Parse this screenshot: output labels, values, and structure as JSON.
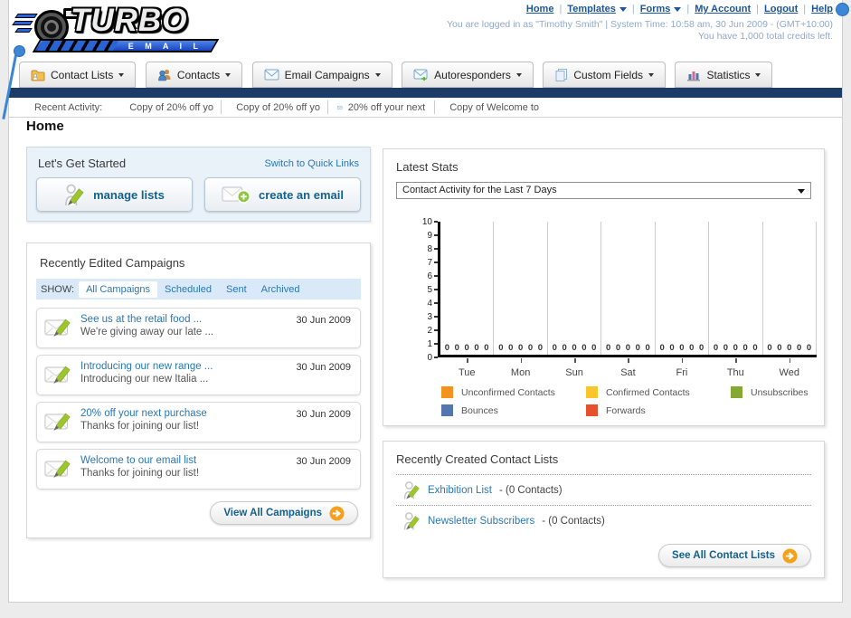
{
  "colors": {
    "navy_bar": "#1B3C66",
    "link_blue": "#2A77B5",
    "header_link_blue": "#1A5699",
    "button_text_blue": "#14618F",
    "accent_orange": "#F5A11C",
    "get_started_bg": "#E9F1F9"
  },
  "header": {
    "logo_title": "TURBO",
    "logo_subtitle": "E M A I L",
    "separator": "|",
    "nav": [
      {
        "label": "Home",
        "dropdown": false
      },
      {
        "label": "Templates",
        "dropdown": true
      },
      {
        "label": "Forms",
        "dropdown": true
      },
      {
        "label": "My Account",
        "dropdown": false
      },
      {
        "label": "Logout",
        "dropdown": false
      },
      {
        "label": "Help",
        "dropdown": false
      }
    ],
    "login_info": "You are logged in as \"Timothy Smith\" | System Time: 10:58 am, 30 Jun 2009 - (GMT+10:00)",
    "credits_info": "You have 1,000 total credits left."
  },
  "nav_tabs": [
    {
      "label": "Contact Lists",
      "icon": "folder-icon"
    },
    {
      "label": "Contacts",
      "icon": "people-icon"
    },
    {
      "label": "Email Campaigns",
      "icon": "envelope-icon"
    },
    {
      "label": "Autoresponders",
      "icon": "envelope-arrow-icon"
    },
    {
      "label": "Custom Fields",
      "icon": "pages-icon"
    },
    {
      "label": "Statistics",
      "icon": "bar-chart-icon"
    }
  ],
  "recent_activity": {
    "label": "Recent Activity:",
    "items": [
      "Copy of 20% off yo",
      "Copy of 20% off yo",
      "20% off your next",
      "Copy of Welcome to"
    ]
  },
  "page_title": "Home",
  "get_started": {
    "title": "Let's Get Started",
    "switch_link": "Switch to Quick Links",
    "manage_lists_label": "manage lists",
    "create_email_label": "create an email"
  },
  "campaigns": {
    "title": "Recently Edited Campaigns",
    "show_label": "SHOW:",
    "filters": [
      "All Campaigns",
      "Scheduled",
      "Sent",
      "Archived"
    ],
    "active_filter": "All Campaigns",
    "items": [
      {
        "title": "See us at the retail food ...",
        "subtitle": "We're giving away our late ...",
        "date": "30 Jun 2009"
      },
      {
        "title": "Introducing our new range ...",
        "subtitle": "Introducing our new Italia ...",
        "date": "30 Jun 2009"
      },
      {
        "title": "20% off your next purchase",
        "subtitle": "Thanks for joining our list!",
        "date": "30 Jun 2009"
      },
      {
        "title": "Welcome to our email list",
        "subtitle": "Thanks for joining our list!",
        "date": "30 Jun 2009"
      }
    ],
    "view_all_label": "View All Campaigns"
  },
  "stats": {
    "title": "Latest Stats",
    "dropdown_value": "Contact Activity for the Last 7 Days",
    "chart_data": {
      "type": "bar",
      "categories": [
        "Tue",
        "Mon",
        "Sun",
        "Sat",
        "Fri",
        "Thu",
        "Wed"
      ],
      "series": [
        {
          "name": "Unconfirmed Contacts",
          "color": "#F5911E",
          "values": [
            0,
            0,
            0,
            0,
            0,
            0,
            0
          ]
        },
        {
          "name": "Confirmed Contacts",
          "color": "#FAC62C",
          "values": [
            0,
            0,
            0,
            0,
            0,
            0,
            0
          ]
        },
        {
          "name": "Unsubscribes",
          "color": "#84A832",
          "values": [
            0,
            0,
            0,
            0,
            0,
            0,
            0
          ]
        },
        {
          "name": "Bounces",
          "color": "#5575AE",
          "values": [
            0,
            0,
            0,
            0,
            0,
            0,
            0
          ]
        },
        {
          "name": "Forwards",
          "color": "#E6502A",
          "values": [
            0,
            0,
            0,
            0,
            0,
            0,
            0
          ]
        }
      ],
      "ylim": [
        0,
        10
      ],
      "yticks": [
        0,
        1,
        2,
        3,
        4,
        5,
        6,
        7,
        8,
        9,
        10
      ],
      "grid": "vertical",
      "legend_position": "bottom"
    }
  },
  "contact_lists": {
    "title": "Recently Created Contact Lists",
    "items": [
      {
        "name": "Exhibition List",
        "suffix": "- (0 Contacts)"
      },
      {
        "name": "Newsletter Subscribers",
        "suffix": "- (0 Contacts)"
      }
    ],
    "see_all_label": "See All Contact Lists"
  }
}
